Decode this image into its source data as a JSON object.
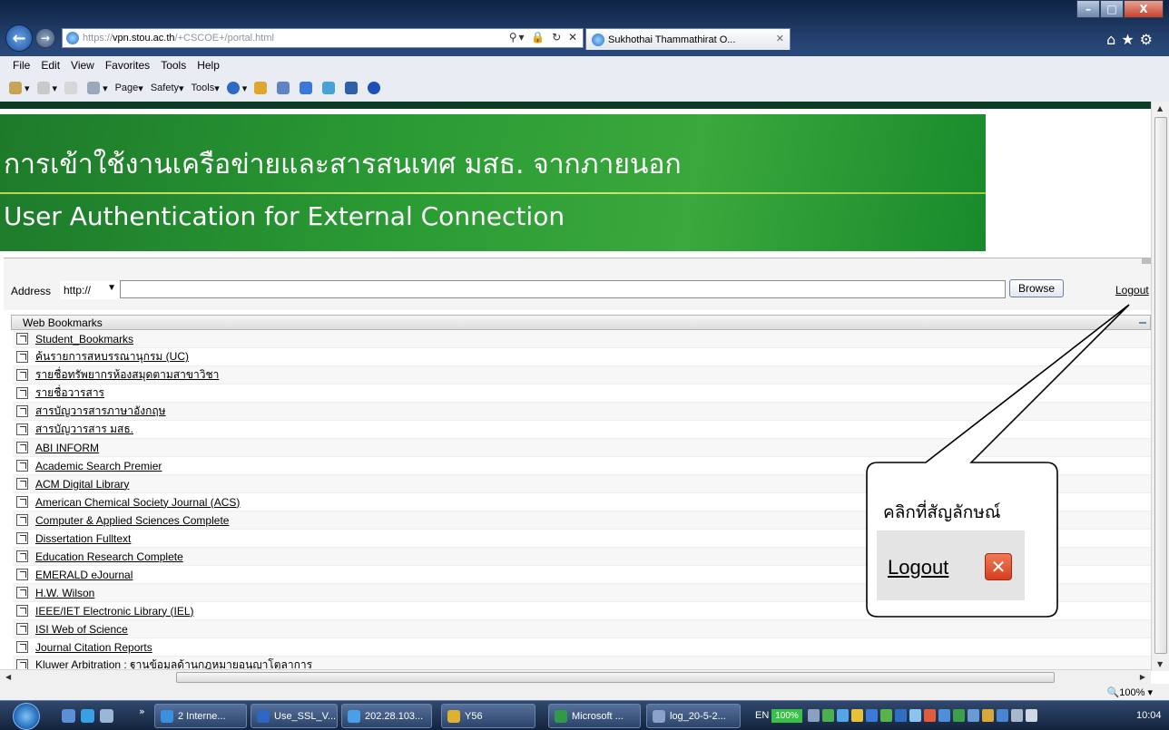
{
  "browser": {
    "url_prefix": "https://",
    "url_host": "vpn.stou.ac.th",
    "url_path": "/+CSCOE+/portal.html",
    "tab_title": "Sukhothai Thammathirat O...",
    "menu": [
      "File",
      "Edit",
      "View",
      "Favorites",
      "Tools",
      "Help"
    ],
    "commands": [
      "Page",
      "Safety",
      "Tools"
    ],
    "window_min": "–",
    "window_max": "□",
    "window_close": "X",
    "tab_close": "✕"
  },
  "banner": {
    "thai_title": "การเข้าใช้งานเครือข่ายและสารสนเทศ มสธ. จากภายนอก",
    "english_title": "User Authentication for External Connection",
    "colors": {
      "dark_green": "#1d7a2a",
      "light_green": "#3aa83c",
      "accent_line": "#e9f27a"
    }
  },
  "toolbar": {
    "address_label": "Address",
    "scheme_value": "http://",
    "address_value": "",
    "browse_label": "Browse",
    "logout_label": "Logout"
  },
  "bookmarks": {
    "header": "Web Bookmarks",
    "items": [
      "Student_Bookmarks",
      "ค้นรายการสหบรรณานุกรม (UC)",
      "รายชื่อทรัพยากรห้องสมุดตามสาขาวิชา",
      "รายชื่อวารสาร",
      "สารบัญวารสารภาษาอังกฤษ",
      "สารบัญวารสาร มสธ.",
      "ABI INFORM",
      "Academic Search Premier",
      "ACM Digital Library",
      "American Chemical Society Journal (ACS)",
      "Computer & Applied Sciences Complete",
      "Dissertation Fulltext",
      "Education Research Complete",
      "EMERALD eJournal",
      "H.W. Wilson",
      "IEEE/IET Electronic Library (IEL)",
      "ISI Web of Science",
      "Journal Citation Reports",
      "Kluwer Arbitration : ฐานข้อมูลด้านกฎหมายอนุญาโตุลาการ"
    ]
  },
  "callout": {
    "instruction": "คลิกที่สัญลักษณ์",
    "logout_sample": "Logout",
    "close_glyph": "✕"
  },
  "statusbar": {
    "zoom": "🔍100%  ▾"
  },
  "taskbar": {
    "quicklaunch_more": "»",
    "buttons": [
      {
        "label": "2 Interne...",
        "color": "#3b8fe0"
      },
      {
        "label": "Use_SSL_V...",
        "color": "#2f66c4"
      },
      {
        "label": "202.28.103...",
        "color": "#4aa0e8"
      },
      {
        "label": "Y56",
        "color": "#e0b030"
      },
      {
        "label": "Microsoft ...",
        "color": "#2f9a48"
      },
      {
        "label": "log_20-5-2...",
        "color": "#8aa2c8"
      }
    ],
    "language": "EN",
    "battery": "100%",
    "clock": "10:04"
  }
}
